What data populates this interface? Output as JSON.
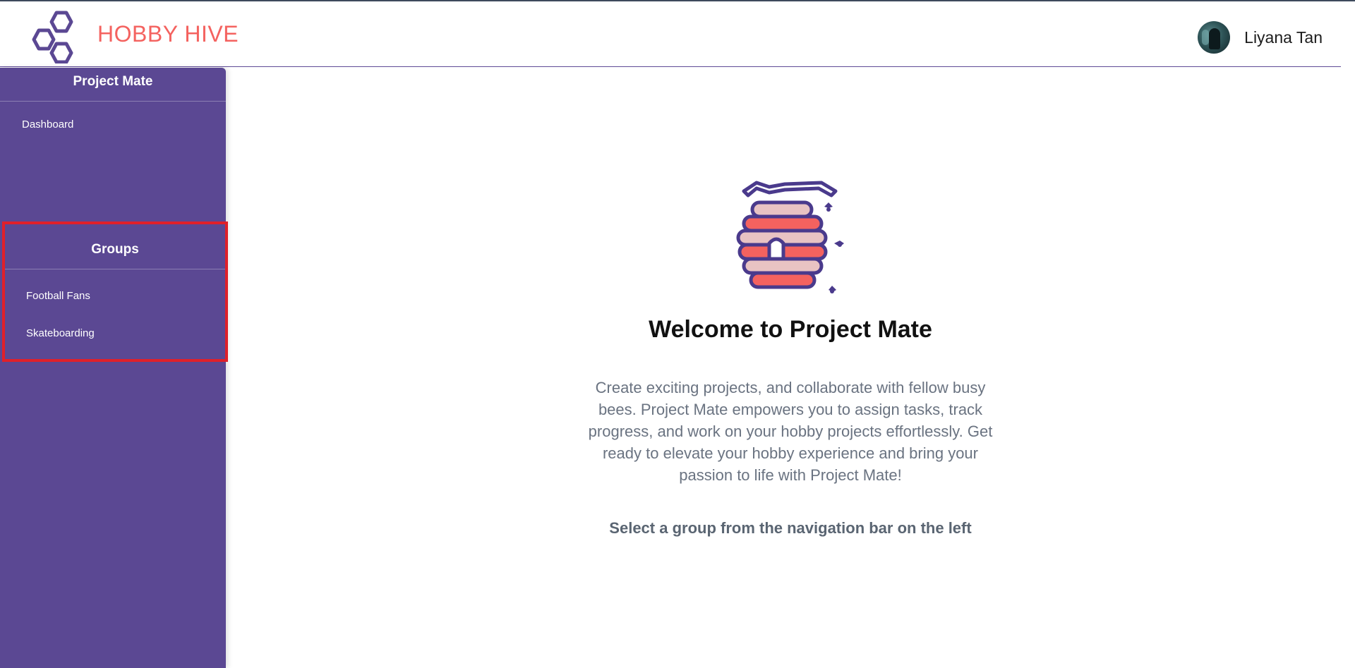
{
  "header": {
    "brand": "HOBBY HIVE",
    "logo_icon": "honeycomb-icon",
    "user": {
      "name": "Liyana Tan",
      "avatar_icon": "user-avatar"
    }
  },
  "sidebar": {
    "title": "Project Mate",
    "items": [
      {
        "label": "Dashboard"
      }
    ],
    "groups": {
      "title": "Groups",
      "items": [
        {
          "label": "Football Fans"
        },
        {
          "label": "Skateboarding"
        }
      ]
    }
  },
  "main": {
    "illustration_icon": "beehive-icon",
    "title": "Welcome to Project Mate",
    "description": "Create exciting projects, and collaborate with fellow busy bees. Project Mate empowers you to assign tasks, track progress, and work on your hobby projects effortlessly. Get ready to elevate your hobby experience and bring your passion to life with Project Mate!",
    "hint": "Select a group from the navigation bar on the left"
  },
  "colors": {
    "brand": "#f4625f",
    "sidebar": "#5b4893",
    "highlight": "#e0202a",
    "hive_stroke": "#4a3a8c",
    "hive_red": "#f4625f",
    "hive_pink": "#e8c3c3"
  }
}
